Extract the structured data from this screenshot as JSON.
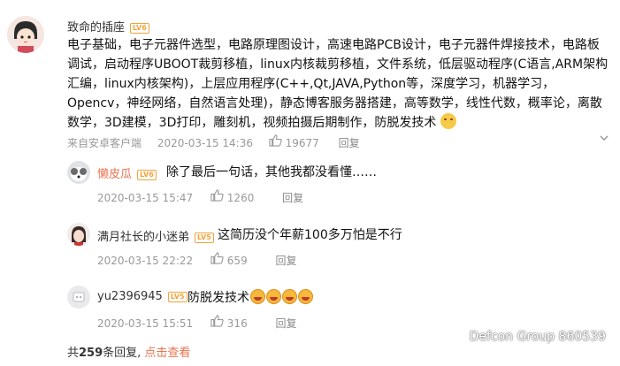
{
  "main_comment": {
    "author": "致命的插座",
    "level": "LV6",
    "content": "电子基础，电子元器件选型，电路原理图设计，高速电路PCB设计，电子元器件焊接技术，电路板调试，启动程序UBOOT裁剪移植，linux内核裁剪移植，文件系统，低层驱动程序(C语言,ARM架构汇编，linux内核架构)，上层应用程序(C++,Qt,JAVA,Python等，深度学习，机器学习，Opencv，神经网络，自然语言处理)，静态博客服务器搭建，高等数学，线性代数，概率论，离散数学，3D建模，3D打印，雕刻机，视频拍摄后期制作，防脱发技术",
    "source": "来自安卓客户端",
    "date": "2020-03-15 14:36",
    "likes": "19677",
    "reply_label": "回复"
  },
  "replies": [
    {
      "name": "懒皮瓜",
      "level": "LV6",
      "text": "除了最后一句话，其他我都没看懂……",
      "date": "2020-03-15 15:47",
      "likes": "1260",
      "reply_label": "回复",
      "name_color": "#eb7350"
    },
    {
      "name": "满月社长的小迷弟",
      "level": "LV5",
      "text": "这简历没个年薪100多万怕是不行",
      "date": "2020-03-15 22:22",
      "likes": "659",
      "reply_label": "回复",
      "name_color": "#333333"
    },
    {
      "name": "yu2396945",
      "level": "LV5",
      "text": "防脱发技术",
      "date": "2020-03-15 15:51",
      "likes": "316",
      "reply_label": "回复",
      "name_color": "#333333"
    }
  ],
  "footer": {
    "prefix": "共",
    "count": "259",
    "suffix": "条回复, ",
    "link": "点击查看"
  },
  "watermark": "Defcon Group 860539",
  "colors": {
    "link": "#eb7350",
    "meta": "#999999",
    "level_badge": "#f2a33a"
  }
}
